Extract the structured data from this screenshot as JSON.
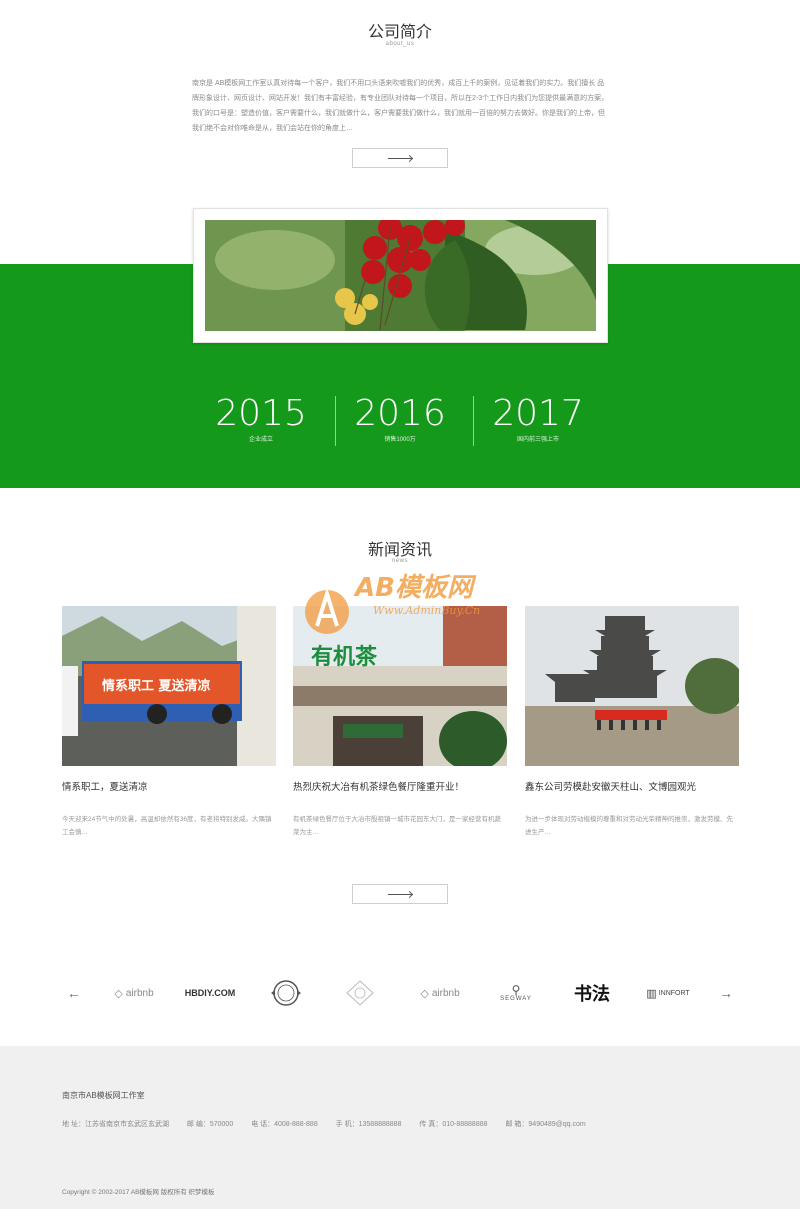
{
  "about": {
    "title": "公司简介",
    "subtitle": "about_us",
    "text": "南京是 AB模板网工作室认真对待每一个客户，我们不用口头语来吹嘘我们的优秀，成百上千的案例，见证着我们的实力。我们擅长 品牌形象设计、网页设计、网站开发！我们有丰富经验，有专业团队对待每一个项目，所以在2-3个工作日内我们为您提供最满意的方案，我们的口号是：塑造价值，客户需要什么，我们就做什么，客户需要我们做什么，我们就用一百倍的努力去做好。你是我们的上帝，但我们绝不会对你唯命是从，我们会站在你的角度上…"
  },
  "stats": [
    {
      "year": "2015",
      "label": "企业成立"
    },
    {
      "year": "2016",
      "label": "销售1000万"
    },
    {
      "year": "2017",
      "label": "国内前三强上市"
    }
  ],
  "news": {
    "title": "新闻资讯",
    "subtitle": "news",
    "items": [
      {
        "title": "情系职工，夏送清凉",
        "desc": "今天迎来24节气中的处暑，高温却依然有36度，有老将特别发威。大隅镇工会慎…",
        "banner": "情系职工 夏送清凉"
      },
      {
        "title": "热烈庆祝大冶有机茶绿色餐厅隆重开业！",
        "desc": "有机茶绿色餐厅位于大冶市殷祖镇一城市花园东大门，是一家经营有机蔬菜为主…",
        "banner": "有机茶"
      },
      {
        "title": "鑫东公司劳模赴安徽天柱山、文博园观光",
        "desc": "为进一步体现对劳动楷模的尊重和对劳动光荣精神的推崇，激发劳模、先进生产…",
        "banner": ""
      }
    ]
  },
  "watermark": {
    "line1": "AB模板网",
    "line2": "Www.AdminBuy.Cn"
  },
  "partners": {
    "prev_icon": "←",
    "next_icon": "→",
    "logos": [
      "airbnb",
      "HBDIY.COM",
      "seal",
      "crest",
      "airbnb",
      "SEGWAY",
      "书法",
      "INNFORT"
    ]
  },
  "footer": {
    "company": "南京市AB模板网工作室",
    "address": "地 址：江苏省南京市玄武区玄武湖",
    "zip": "邮 编：570000",
    "phone": "电 话：4008-888-888",
    "mobile": "手 机：13588888888",
    "fax": "传 真：010-88888888",
    "email": "邮 箱：9490489@qq.com",
    "copyright": "Copyright © 2002-2017 AB模板网 版权所有 织梦模板"
  },
  "colors": {
    "accent": "#15991b",
    "footer_bg": "#f0f0f0"
  }
}
